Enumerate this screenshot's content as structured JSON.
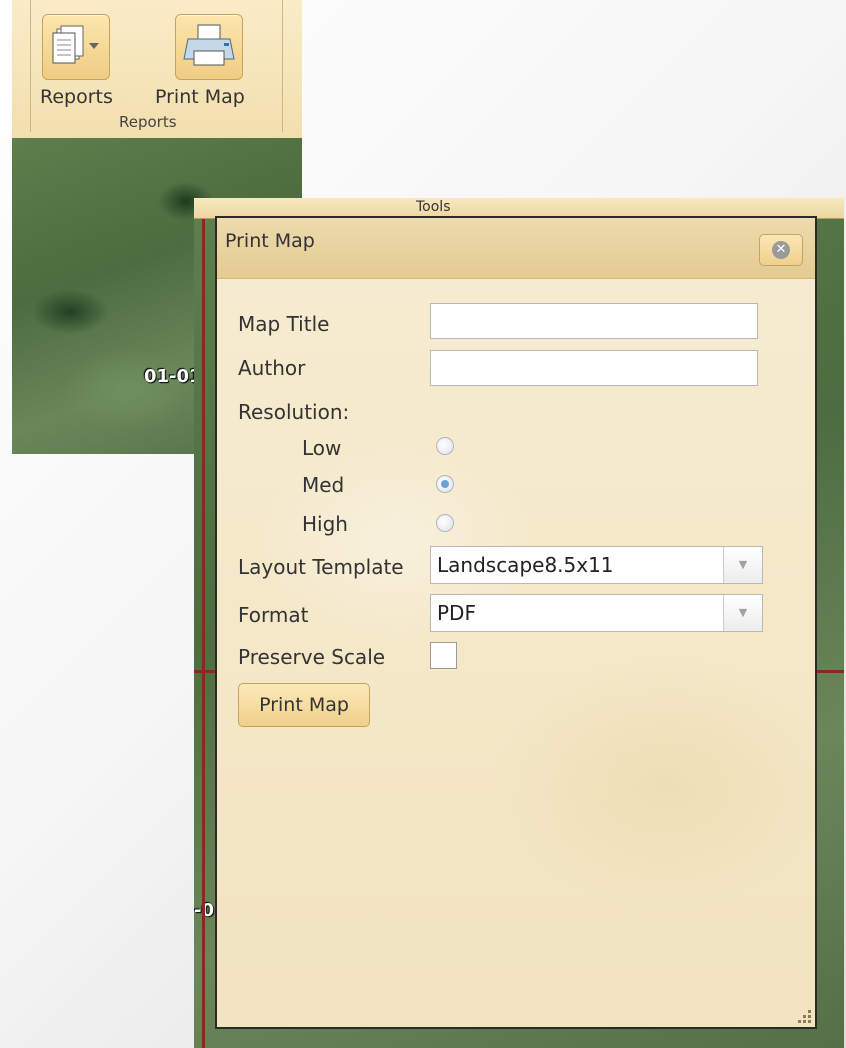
{
  "ribbon": {
    "reports_label": "Reports",
    "print_map_label": "Print Map",
    "group_label": "Reports",
    "reports_icon": "document-stack-icon",
    "print_icon": "printer-icon"
  },
  "map": {
    "parcel_label_top": "01-01",
    "parcel_label_bottom": "-0"
  },
  "tools_strip": {
    "label": "Tools"
  },
  "dialog": {
    "title": "Print Map",
    "close_icon": "close-icon",
    "fields": {
      "map_title_label": "Map Title",
      "map_title_value": "",
      "author_label": "Author",
      "author_value": "",
      "resolution_label": "Resolution:",
      "resolution_options": [
        "Low",
        "Med",
        "High"
      ],
      "resolution_selected": "Med",
      "layout_template_label": "Layout Template",
      "layout_template_value": "Landscape8.5x11",
      "format_label": "Format",
      "format_value": "PDF",
      "preserve_scale_label": "Preserve Scale",
      "preserve_scale_checked": false
    },
    "print_button_label": "Print Map"
  },
  "colors": {
    "dialog_bg": "#f4e6c5",
    "button_bg": "#f3d89a",
    "radio_selected": "#6aa3d4"
  }
}
